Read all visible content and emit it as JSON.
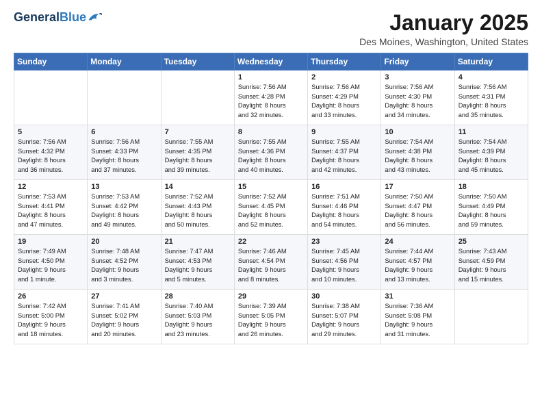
{
  "header": {
    "logo_general": "General",
    "logo_blue": "Blue",
    "month": "January 2025",
    "location": "Des Moines, Washington, United States"
  },
  "weekdays": [
    "Sunday",
    "Monday",
    "Tuesday",
    "Wednesday",
    "Thursday",
    "Friday",
    "Saturday"
  ],
  "weeks": [
    [
      {
        "day": "",
        "info": ""
      },
      {
        "day": "",
        "info": ""
      },
      {
        "day": "",
        "info": ""
      },
      {
        "day": "1",
        "info": "Sunrise: 7:56 AM\nSunset: 4:28 PM\nDaylight: 8 hours\nand 32 minutes."
      },
      {
        "day": "2",
        "info": "Sunrise: 7:56 AM\nSunset: 4:29 PM\nDaylight: 8 hours\nand 33 minutes."
      },
      {
        "day": "3",
        "info": "Sunrise: 7:56 AM\nSunset: 4:30 PM\nDaylight: 8 hours\nand 34 minutes."
      },
      {
        "day": "4",
        "info": "Sunrise: 7:56 AM\nSunset: 4:31 PM\nDaylight: 8 hours\nand 35 minutes."
      }
    ],
    [
      {
        "day": "5",
        "info": "Sunrise: 7:56 AM\nSunset: 4:32 PM\nDaylight: 8 hours\nand 36 minutes."
      },
      {
        "day": "6",
        "info": "Sunrise: 7:56 AM\nSunset: 4:33 PM\nDaylight: 8 hours\nand 37 minutes."
      },
      {
        "day": "7",
        "info": "Sunrise: 7:55 AM\nSunset: 4:35 PM\nDaylight: 8 hours\nand 39 minutes."
      },
      {
        "day": "8",
        "info": "Sunrise: 7:55 AM\nSunset: 4:36 PM\nDaylight: 8 hours\nand 40 minutes."
      },
      {
        "day": "9",
        "info": "Sunrise: 7:55 AM\nSunset: 4:37 PM\nDaylight: 8 hours\nand 42 minutes."
      },
      {
        "day": "10",
        "info": "Sunrise: 7:54 AM\nSunset: 4:38 PM\nDaylight: 8 hours\nand 43 minutes."
      },
      {
        "day": "11",
        "info": "Sunrise: 7:54 AM\nSunset: 4:39 PM\nDaylight: 8 hours\nand 45 minutes."
      }
    ],
    [
      {
        "day": "12",
        "info": "Sunrise: 7:53 AM\nSunset: 4:41 PM\nDaylight: 8 hours\nand 47 minutes."
      },
      {
        "day": "13",
        "info": "Sunrise: 7:53 AM\nSunset: 4:42 PM\nDaylight: 8 hours\nand 49 minutes."
      },
      {
        "day": "14",
        "info": "Sunrise: 7:52 AM\nSunset: 4:43 PM\nDaylight: 8 hours\nand 50 minutes."
      },
      {
        "day": "15",
        "info": "Sunrise: 7:52 AM\nSunset: 4:45 PM\nDaylight: 8 hours\nand 52 minutes."
      },
      {
        "day": "16",
        "info": "Sunrise: 7:51 AM\nSunset: 4:46 PM\nDaylight: 8 hours\nand 54 minutes."
      },
      {
        "day": "17",
        "info": "Sunrise: 7:50 AM\nSunset: 4:47 PM\nDaylight: 8 hours\nand 56 minutes."
      },
      {
        "day": "18",
        "info": "Sunrise: 7:50 AM\nSunset: 4:49 PM\nDaylight: 8 hours\nand 59 minutes."
      }
    ],
    [
      {
        "day": "19",
        "info": "Sunrise: 7:49 AM\nSunset: 4:50 PM\nDaylight: 9 hours\nand 1 minute."
      },
      {
        "day": "20",
        "info": "Sunrise: 7:48 AM\nSunset: 4:52 PM\nDaylight: 9 hours\nand 3 minutes."
      },
      {
        "day": "21",
        "info": "Sunrise: 7:47 AM\nSunset: 4:53 PM\nDaylight: 9 hours\nand 5 minutes."
      },
      {
        "day": "22",
        "info": "Sunrise: 7:46 AM\nSunset: 4:54 PM\nDaylight: 9 hours\nand 8 minutes."
      },
      {
        "day": "23",
        "info": "Sunrise: 7:45 AM\nSunset: 4:56 PM\nDaylight: 9 hours\nand 10 minutes."
      },
      {
        "day": "24",
        "info": "Sunrise: 7:44 AM\nSunset: 4:57 PM\nDaylight: 9 hours\nand 13 minutes."
      },
      {
        "day": "25",
        "info": "Sunrise: 7:43 AM\nSunset: 4:59 PM\nDaylight: 9 hours\nand 15 minutes."
      }
    ],
    [
      {
        "day": "26",
        "info": "Sunrise: 7:42 AM\nSunset: 5:00 PM\nDaylight: 9 hours\nand 18 minutes."
      },
      {
        "day": "27",
        "info": "Sunrise: 7:41 AM\nSunset: 5:02 PM\nDaylight: 9 hours\nand 20 minutes."
      },
      {
        "day": "28",
        "info": "Sunrise: 7:40 AM\nSunset: 5:03 PM\nDaylight: 9 hours\nand 23 minutes."
      },
      {
        "day": "29",
        "info": "Sunrise: 7:39 AM\nSunset: 5:05 PM\nDaylight: 9 hours\nand 26 minutes."
      },
      {
        "day": "30",
        "info": "Sunrise: 7:38 AM\nSunset: 5:07 PM\nDaylight: 9 hours\nand 29 minutes."
      },
      {
        "day": "31",
        "info": "Sunrise: 7:36 AM\nSunset: 5:08 PM\nDaylight: 9 hours\nand 31 minutes."
      },
      {
        "day": "",
        "info": ""
      }
    ]
  ]
}
